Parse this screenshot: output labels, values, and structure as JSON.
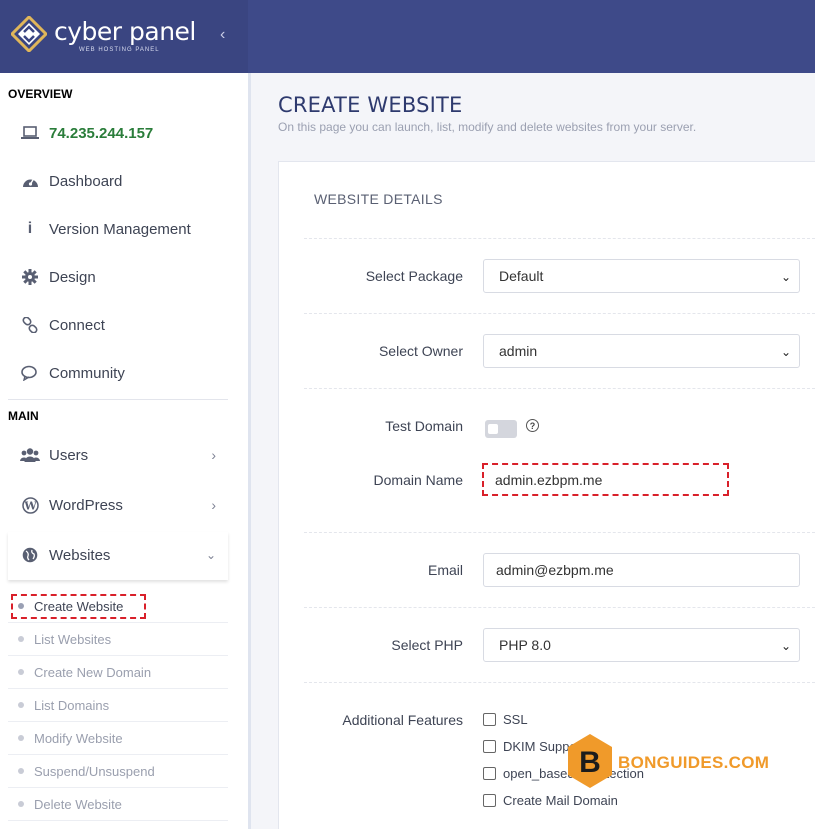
{
  "brand": {
    "name": "cyber panel",
    "tagline": "WEB HOSTING PANEL",
    "header_color": "#3a4581",
    "topbar_color": "#3e4a89"
  },
  "sidebar": {
    "overview_label": "OVERVIEW",
    "ip": "74.235.244.157",
    "overview_items": [
      {
        "label": "Dashboard",
        "icon": "dashboard-icon"
      },
      {
        "label": "Version Management",
        "icon": "info-icon"
      },
      {
        "label": "Design",
        "icon": "gear-icon"
      },
      {
        "label": "Connect",
        "icon": "link-icon"
      },
      {
        "label": "Community",
        "icon": "comments-icon"
      }
    ],
    "main_label": "MAIN",
    "main_items": [
      {
        "label": "Users",
        "icon": "users-icon"
      },
      {
        "label": "WordPress",
        "icon": "wordpress-icon"
      },
      {
        "label": "Websites",
        "icon": "globe-icon"
      }
    ],
    "websites_sub": [
      "Create Website",
      "List Websites",
      "Create New Domain",
      "List Domains",
      "Modify Website",
      "Suspend/Unsuspend",
      "Delete Website"
    ],
    "active_sub": "Create Website"
  },
  "page": {
    "title": "CREATE WEBSITE",
    "description": "On this page you can launch, list, modify and delete websites from your server."
  },
  "form": {
    "section_title": "WEBSITE DETAILS",
    "package_label": "Select Package",
    "package_value": "Default",
    "owner_label": "Select Owner",
    "owner_value": "admin",
    "test_domain_label": "Test Domain",
    "domain_label": "Domain Name",
    "domain_value": "admin.ezbpm.me",
    "email_label": "Email",
    "email_value": "admin@ezbpm.me",
    "php_label": "Select PHP",
    "php_value": "PHP 8.0",
    "features_label": "Additional Features",
    "features": [
      "SSL",
      "DKIM Support",
      "open_basedir Protection",
      "Create Mail Domain"
    ]
  },
  "watermark": {
    "letter": "B",
    "text": "BONGUIDES.COM",
    "color": "#f09a2a"
  }
}
